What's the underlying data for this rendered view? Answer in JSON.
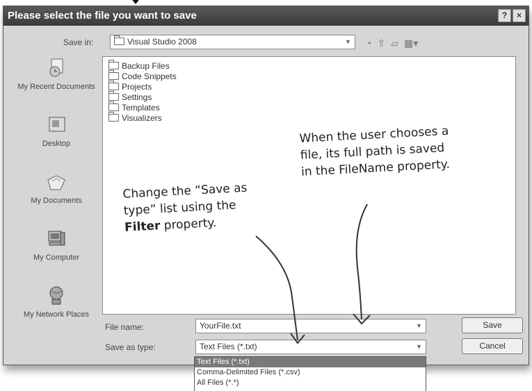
{
  "dialog": {
    "title": "Please select the file you want to save",
    "help_button": "?",
    "close_button": "×",
    "save_in_label": "Save in:",
    "save_in_value": "Visual Studio 2008",
    "file_name_label": "File name:",
    "file_name_value": "YourFile.txt",
    "save_as_type_label": "Save as type:",
    "save_as_type_value": "Text Files (*.txt)",
    "save_button": "Save",
    "cancel_button": "Cancel"
  },
  "places": [
    {
      "label": "My Recent Documents",
      "icon": "recent-documents-icon"
    },
    {
      "label": "Desktop",
      "icon": "desktop-icon"
    },
    {
      "label": "My Documents",
      "icon": "my-documents-icon"
    },
    {
      "label": "My Computer",
      "icon": "my-computer-icon"
    },
    {
      "label": "My Network Places",
      "icon": "network-places-icon"
    }
  ],
  "files": [
    "Backup Files",
    "Code Snippets",
    "Projects",
    "Settings",
    "Templates",
    "Visualizers"
  ],
  "type_options": [
    "Text Files (*.txt)",
    "Comma-Delimited Files (*.csv)",
    "All Files (*.*)"
  ],
  "annotations": {
    "filter_note_1": "Change the “Save as",
    "filter_note_2": "type” list using the",
    "filter_note_3a": "Filter",
    "filter_note_3b": " property.",
    "filename_note_1": "When the user chooses a",
    "filename_note_2": "file, its full path is saved",
    "filename_note_3": "in the FileName property."
  },
  "colors": {
    "titlebar": "#3a3a3a",
    "dialog_bg": "#d6d6d6",
    "selected_item": "#7a7a7a"
  }
}
